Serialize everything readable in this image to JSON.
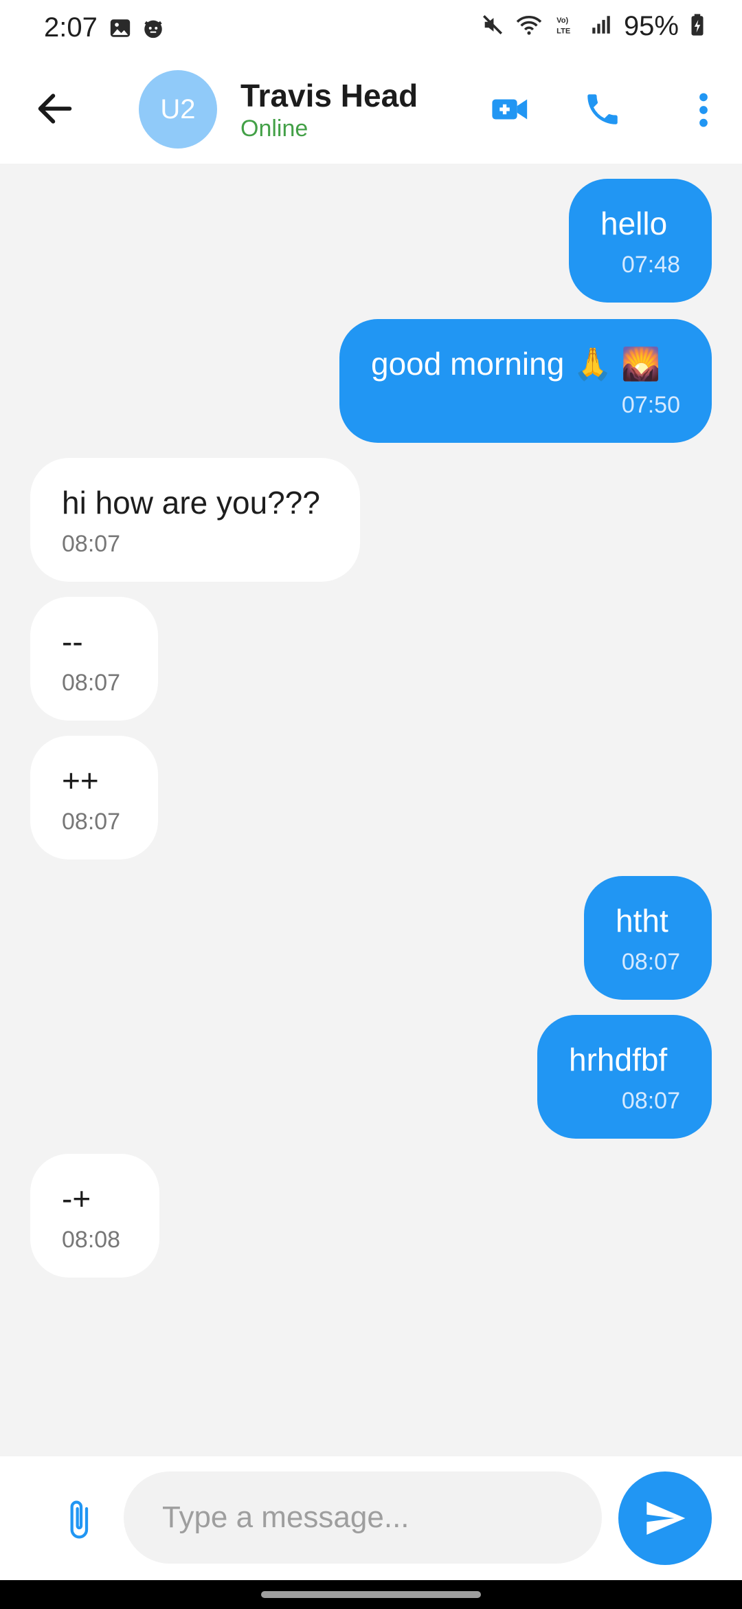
{
  "status_bar": {
    "time": "2:07",
    "battery": "95%",
    "left_icons": [
      "gallery-icon",
      "cat-face-icon"
    ],
    "right_icons": [
      "mute-icon",
      "wifi-icon",
      "volte-icon",
      "signal-icon",
      "battery-icon"
    ]
  },
  "header": {
    "avatar_initials": "U2",
    "contact_name": "Travis Head",
    "contact_status": "Online",
    "icons": [
      "back-arrow-icon",
      "video-call-icon",
      "phone-icon",
      "more-vert-icon"
    ]
  },
  "messages": [
    {
      "direction": "sent",
      "text": "hello",
      "time": "07:48"
    },
    {
      "direction": "sent",
      "text": "good morning 🙏 🌄",
      "time": "07:50"
    },
    {
      "direction": "received",
      "text": "hi how are you???",
      "time": "08:07"
    },
    {
      "direction": "received",
      "text": "--",
      "time": "08:07"
    },
    {
      "direction": "received",
      "text": "++",
      "time": "08:07"
    },
    {
      "direction": "sent",
      "text": "htht",
      "time": "08:07"
    },
    {
      "direction": "sent",
      "text": "hrhdfbf",
      "time": "08:07"
    },
    {
      "direction": "received",
      "text": "-+",
      "time": "08:08"
    }
  ],
  "composer": {
    "placeholder": "Type a message...",
    "value": "",
    "icons": [
      "paperclip-icon",
      "send-icon"
    ]
  },
  "colors": {
    "accent": "#2196f3",
    "avatar_bg": "#90caf9",
    "online": "#43a047",
    "chat_bg": "#f3f3f3",
    "received_bubble": "#ffffff"
  }
}
